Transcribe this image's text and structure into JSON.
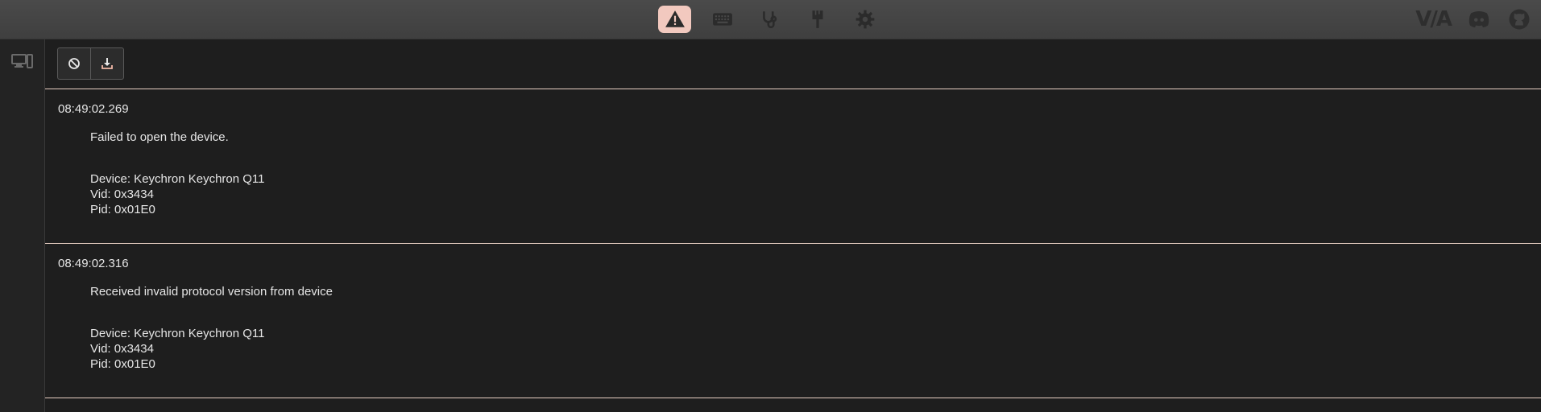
{
  "nav": {
    "items": [
      {
        "name": "errors",
        "icon": "warning-icon",
        "active": true
      },
      {
        "name": "configure",
        "icon": "keyboard-icon",
        "active": false
      },
      {
        "name": "test",
        "icon": "stethoscope-icon",
        "active": false
      },
      {
        "name": "design",
        "icon": "brush-icon",
        "active": false
      },
      {
        "name": "settings",
        "icon": "gear-icon",
        "active": false
      }
    ],
    "brand": "V/A",
    "right_icons": [
      "discord-icon",
      "github-icon"
    ],
    "active_color": "#f2c9bf"
  },
  "sidebar": {
    "icon": "devices-icon"
  },
  "toolbar": {
    "buttons": [
      "clear-icon",
      "download-icon"
    ]
  },
  "logs": [
    {
      "time": "08:49:02.269",
      "message": "Failed to open the device.",
      "device": "Device: Keychron Keychron Q11",
      "vid": "Vid: 0x3434",
      "pid": "Pid: 0x01E0"
    },
    {
      "time": "08:49:02.316",
      "message": "Received invalid protocol version from device",
      "device": "Device: Keychron Keychron Q11",
      "vid": "Vid: 0x3434",
      "pid": "Pid: 0x01E0"
    }
  ]
}
